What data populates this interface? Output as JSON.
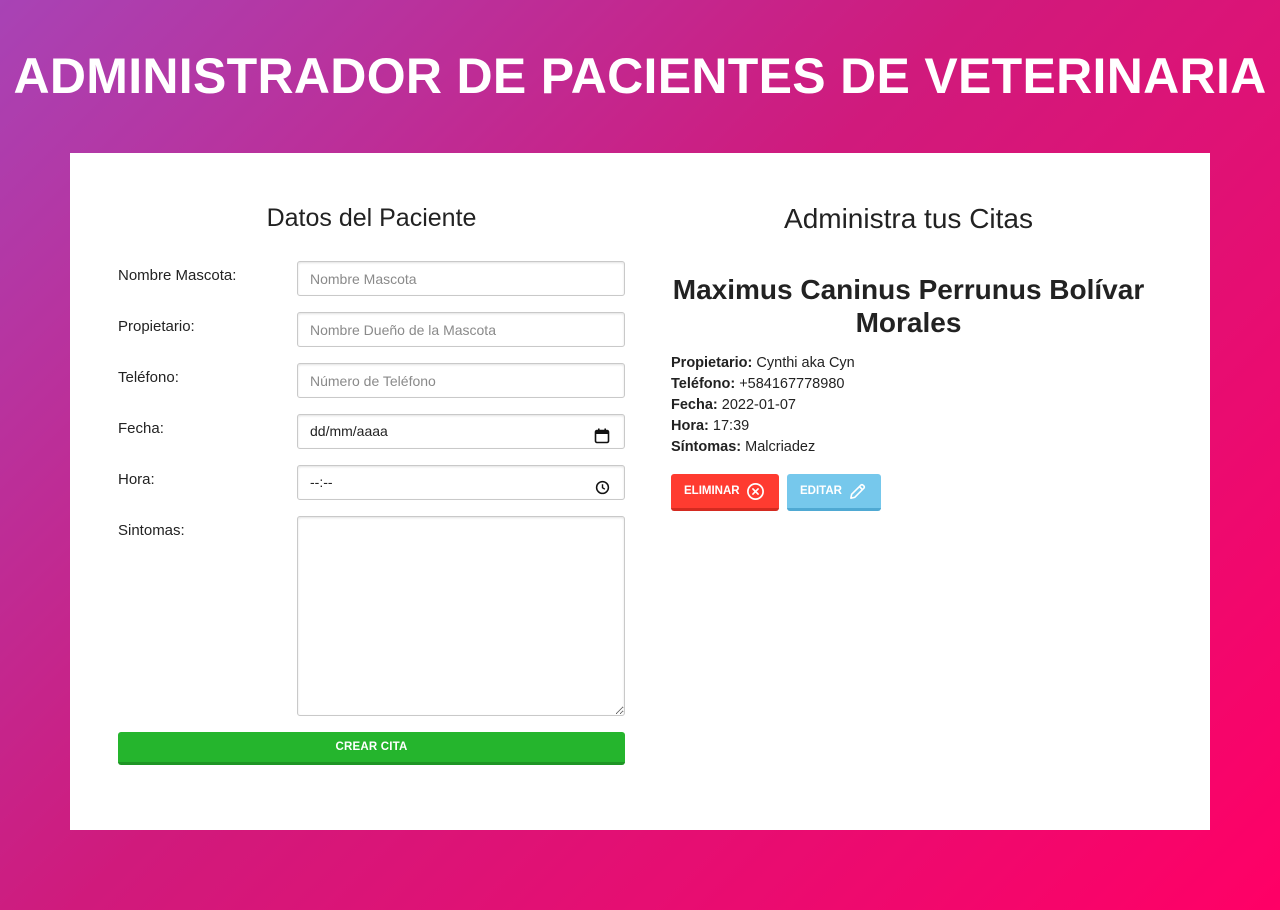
{
  "header": {
    "title": "ADMINISTRADOR DE PACIENTES DE VETERINARIA"
  },
  "form": {
    "title": "Datos del Paciente",
    "fields": {
      "pet": {
        "label": "Nombre Mascota:",
        "placeholder": "Nombre Mascota",
        "value": ""
      },
      "owner": {
        "label": "Propietario:",
        "placeholder": "Nombre Dueño de la Mascota",
        "value": ""
      },
      "phone": {
        "label": "Teléfono:",
        "placeholder": "Número de Teléfono",
        "value": ""
      },
      "date": {
        "label": "Fecha:",
        "display": "dd/mm/aaaa"
      },
      "time": {
        "label": "Hora:",
        "display": "--:--"
      },
      "symptoms": {
        "label": "Sintomas:",
        "value": ""
      }
    },
    "submit_label": "Crear Cita"
  },
  "appointments": {
    "title": "Administra tus Citas",
    "items": [
      {
        "pet_name": "Maximus Caninus Perrunus Bolívar Morales",
        "owner_label": "Propietario:",
        "owner": "Cynthi aka Cyn",
        "phone_label": "Teléfono:",
        "phone": "+584167778980",
        "date_label": "Fecha:",
        "date": "2022-01-07",
        "time_label": "Hora:",
        "time": "17:39",
        "symptoms_label": "Síntomas:",
        "symptoms": "Malcriadez",
        "delete_label": "Eliminar",
        "edit_label": "Editar"
      }
    ]
  },
  "icons": {
    "delete": "x-circle-icon",
    "edit": "pencil-icon",
    "calendar": "calendar-icon",
    "clock": "clock-icon"
  },
  "colors": {
    "gradient_start": "#a843b5",
    "gradient_end": "#ff0066",
    "submit": "#25b52d",
    "delete": "#ff3b30",
    "edit": "#76c8ec"
  }
}
